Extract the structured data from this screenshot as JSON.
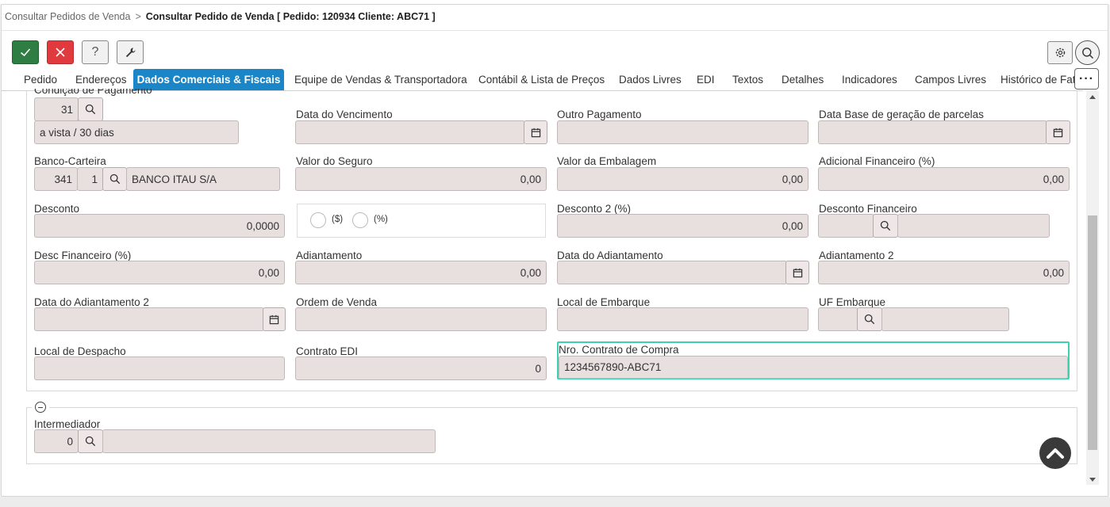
{
  "breadcrumb": {
    "parent": "Consultar Pedidos de Venda",
    "separator": ">",
    "current": "Consultar Pedido de Venda [ Pedido: 120934 Cliente: ABC71 ]"
  },
  "toolbar": {
    "help_label": "?"
  },
  "tabs": [
    {
      "label": "Pedido",
      "active": false
    },
    {
      "label": "Endereços",
      "active": false
    },
    {
      "label": "Dados Comerciais & Fiscais",
      "active": true
    },
    {
      "label": "Equipe de Vendas & Transportadora",
      "active": false
    },
    {
      "label": "Contábil & Lista de Preços",
      "active": false
    },
    {
      "label": "Dados Livres",
      "active": false
    },
    {
      "label": "EDI",
      "active": false
    },
    {
      "label": "Textos",
      "active": false
    },
    {
      "label": "Detalhes",
      "active": false
    },
    {
      "label": "Indicadores",
      "active": false
    },
    {
      "label": "Campos Livres",
      "active": false
    },
    {
      "label": "Histórico de Fatu",
      "active": false
    }
  ],
  "more_tabs_label": "···",
  "form": {
    "condicao_pagamento": {
      "label": "Condição de Pagamento",
      "code": "31",
      "description": "a vista / 30 dias"
    },
    "data_vencimento": {
      "label": "Data do Vencimento",
      "value": ""
    },
    "outro_pagamento": {
      "label": "Outro Pagamento",
      "value": ""
    },
    "data_base_parcelas": {
      "label": "Data Base de geração de parcelas",
      "value": ""
    },
    "banco_carteira": {
      "label": "Banco-Carteira",
      "bank_code": "341",
      "wallet": "1",
      "bank_name": "BANCO ITAU S/A"
    },
    "valor_seguro": {
      "label": "Valor do Seguro",
      "value": "0,00"
    },
    "valor_embalagem": {
      "label": "Valor da Embalagem",
      "value": "0,00"
    },
    "adicional_financeiro": {
      "label": "Adicional Financeiro (%)",
      "value": "0,00"
    },
    "desconto": {
      "label": "Desconto",
      "value": "0,0000"
    },
    "desconto_tipo": {
      "option_currency": "($)",
      "option_percent": "(%)"
    },
    "desconto2": {
      "label": "Desconto 2 (%)",
      "value": "0,00"
    },
    "desconto_financeiro": {
      "label": "Desconto Financeiro",
      "code": "",
      "description": ""
    },
    "desc_financeiro_pct": {
      "label": "Desc Financeiro (%)",
      "value": "0,00"
    },
    "adiantamento": {
      "label": "Adiantamento",
      "value": "0,00"
    },
    "data_adiantamento": {
      "label": "Data do Adiantamento",
      "value": ""
    },
    "adiantamento2": {
      "label": "Adiantamento 2",
      "value": "0,00"
    },
    "data_adiantamento2": {
      "label": "Data do Adiantamento 2",
      "value": ""
    },
    "ordem_venda": {
      "label": "Ordem de Venda",
      "value": ""
    },
    "local_embarque": {
      "label": "Local de Embarque",
      "value": ""
    },
    "uf_embarque": {
      "label": "UF Embarque",
      "code": "",
      "description": ""
    },
    "local_despacho": {
      "label": "Local de Despacho",
      "value": ""
    },
    "contrato_edi": {
      "label": "Contrato EDI",
      "value": "0"
    },
    "nro_contrato_compra": {
      "label": "Nro. Contrato de Compra",
      "value": "1234567890-ABC71"
    }
  },
  "intermediador": {
    "label": "Intermediador",
    "code": "0",
    "description": ""
  }
}
